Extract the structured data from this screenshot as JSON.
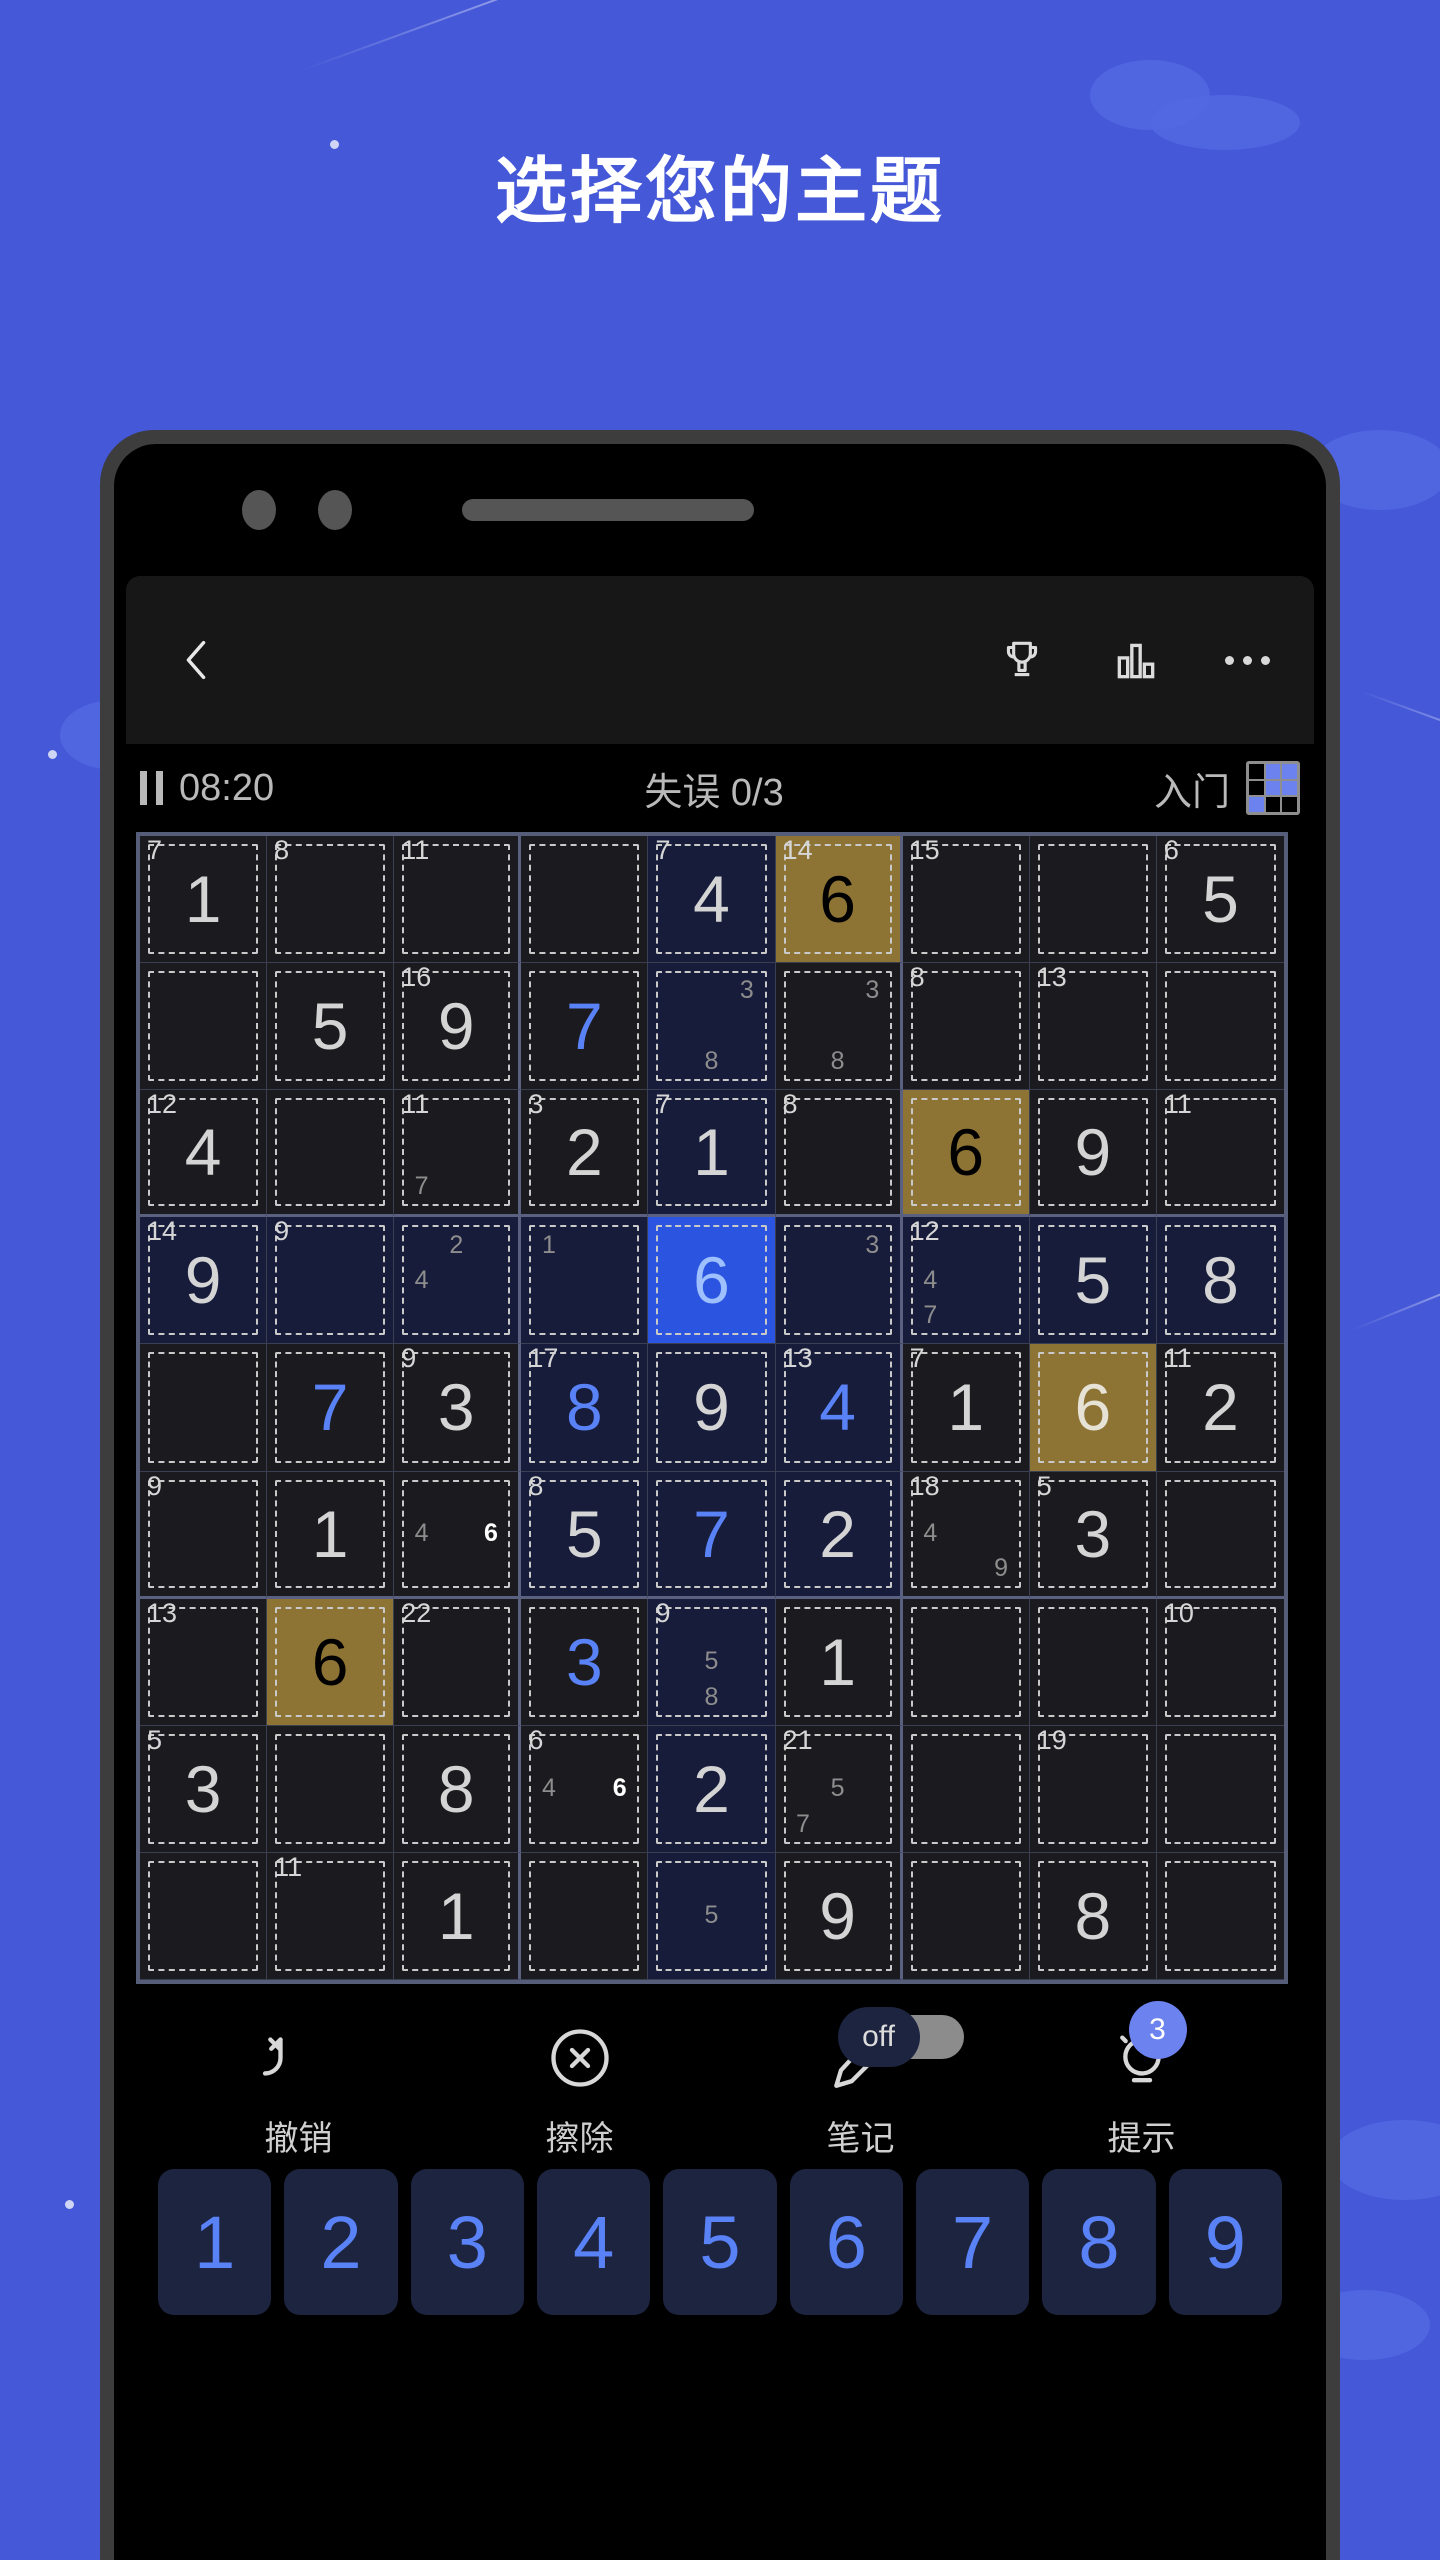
{
  "headline": "选择您的主题",
  "appbar": {
    "back_icon": "chevron-left-icon",
    "icons": [
      "trophy-icon",
      "stats-bar-icon",
      "more-dots-icon"
    ]
  },
  "status": {
    "pause_icon": "pause-icon",
    "timer": "08:20",
    "mistakes": "失误 0/3",
    "difficulty": "入门",
    "difficulty_grid": [
      0,
      1,
      1,
      0,
      1,
      1,
      1,
      0,
      0
    ]
  },
  "actions": [
    {
      "label": "撤销",
      "icon": "undo-arrow-icon"
    },
    {
      "label": "擦除",
      "icon": "erase-circle-x-icon"
    },
    {
      "label": "笔记",
      "icon": "pencil-note-icon",
      "toggle": "off"
    },
    {
      "label": "提示",
      "icon": "lightbulb-icon",
      "badge": "3"
    }
  ],
  "numpad": [
    "1",
    "2",
    "3",
    "4",
    "5",
    "6",
    "7",
    "8",
    "9"
  ],
  "colors": {
    "background": "#4458d8",
    "accent": "#5a82f7",
    "selected": "#2b55e0",
    "gold": "#8d7434",
    "board_bg": "#1b1b1f"
  },
  "board": {
    "selected": [
      3,
      4
    ],
    "rows": [
      [
        {
          "sum": "7",
          "v": "1",
          "t": "given",
          "cage": "tl"
        },
        {
          "sum": "8",
          "v": "",
          "cage": "tl"
        },
        {
          "sum": "11",
          "v": "",
          "cage": "tl"
        },
        {
          "v": "",
          "cage": "tr"
        },
        {
          "sum": "7",
          "v": "4",
          "t": "given",
          "hl": "col"
        },
        {
          "sum": "14",
          "v": "6",
          "t": "gold",
          "gold": true
        },
        {
          "sum": "15",
          "v": "",
          "cage": "tl"
        },
        {
          "v": "",
          "cage": "tr"
        },
        {
          "sum": "6",
          "v": "5",
          "t": "given",
          "cage": "tl"
        }
      ],
      [
        {
          "v": ""
        },
        {
          "v": "5",
          "t": "given"
        },
        {
          "sum": "16",
          "v": "9",
          "t": "given",
          "cage": "tl"
        },
        {
          "v": "7",
          "t": "user",
          "cage": "tr"
        },
        {
          "v": "",
          "notes": {
            "3": "3",
            "8": "8"
          },
          "hl": "col"
        },
        {
          "v": "",
          "notes": {
            "3": "3",
            "8": "8"
          }
        },
        {
          "sum": "8",
          "v": "",
          "cage": "tl"
        },
        {
          "sum": "13",
          "v": "",
          "cage": "tl"
        },
        {
          "v": ""
        }
      ],
      [
        {
          "sum": "12",
          "v": "4",
          "t": "given",
          "cage": "tl"
        },
        {
          "v": "",
          "cage": "tr"
        },
        {
          "sum": "11",
          "v": "",
          "notes": {
            "7": "7"
          }
        },
        {
          "sum": "3",
          "v": "2",
          "t": "given"
        },
        {
          "sum": "7",
          "v": "1",
          "t": "given",
          "hl": "col"
        },
        {
          "sum": "8",
          "v": ""
        },
        {
          "v": "6",
          "t": "gold",
          "gold": true
        },
        {
          "v": "9",
          "t": "given"
        },
        {
          "sum": "11",
          "v": ""
        }
      ],
      [
        {
          "sum": "14",
          "v": "9",
          "t": "given",
          "hl": "row"
        },
        {
          "sum": "9",
          "v": "",
          "hl": "row"
        },
        {
          "v": "",
          "notes": {
            "2": "2",
            "4": "4"
          },
          "hl": "row"
        },
        {
          "v": "",
          "notes": {
            "1": "1"
          },
          "hl": "row"
        },
        {
          "v": "6",
          "t": "onsel",
          "sel": true
        },
        {
          "v": "",
          "notes": {
            "3": "3"
          },
          "hl": "row"
        },
        {
          "sum": "12",
          "v": "",
          "notes": {
            "4": "4",
            "7": "7"
          },
          "hl": "row"
        },
        {
          "v": "5",
          "t": "given",
          "hl": "row"
        },
        {
          "v": "8",
          "t": "given",
          "hl": "row"
        }
      ],
      [
        {
          "v": ""
        },
        {
          "v": "7",
          "t": "user"
        },
        {
          "sum": "9",
          "v": "3",
          "t": "given"
        },
        {
          "sum": "17",
          "v": "8",
          "t": "user",
          "hl": "col"
        },
        {
          "v": "9",
          "t": "given",
          "hl": "col"
        },
        {
          "sum": "13",
          "v": "4",
          "t": "user",
          "hl": "col"
        },
        {
          "sum": "7",
          "v": "1",
          "t": "given"
        },
        {
          "v": "6",
          "t": "ongold",
          "gold": true
        },
        {
          "sum": "11",
          "v": "2",
          "t": "given"
        }
      ],
      [
        {
          "sum": "9",
          "v": ""
        },
        {
          "v": "1",
          "t": "given"
        },
        {
          "v": "",
          "notes": {
            "4": "4",
            "6": "6"
          },
          "bold": "6"
        },
        {
          "sum": "8",
          "v": "5",
          "t": "given",
          "hl": "col"
        },
        {
          "v": "7",
          "t": "user",
          "hl": "col"
        },
        {
          "v": "2",
          "t": "given",
          "hl": "col"
        },
        {
          "sum": "18",
          "v": "",
          "notes": {
            "4": "4",
            "9": "9"
          }
        },
        {
          "sum": "5",
          "v": "3",
          "t": "given"
        },
        {
          "v": ""
        }
      ],
      [
        {
          "sum": "13",
          "v": ""
        },
        {
          "v": "6",
          "t": "gold",
          "gold": true
        },
        {
          "sum": "22",
          "v": ""
        },
        {
          "v": "3",
          "t": "user"
        },
        {
          "sum": "9",
          "v": "",
          "notes": {
            "5": "5",
            "8": "8"
          },
          "hl": "col"
        },
        {
          "v": "1",
          "t": "given"
        },
        {
          "v": ""
        },
        {
          "v": ""
        },
        {
          "sum": "10",
          "v": ""
        }
      ],
      [
        {
          "sum": "5",
          "v": "3",
          "t": "given"
        },
        {
          "v": ""
        },
        {
          "v": "8",
          "t": "given"
        },
        {
          "sum": "6",
          "v": "",
          "notes": {
            "4": "4",
            "6": "6"
          },
          "bold": "6"
        },
        {
          "v": "2",
          "t": "given",
          "hl": "col"
        },
        {
          "sum": "21",
          "v": "",
          "notes": {
            "5": "5",
            "7": "7"
          }
        },
        {
          "v": ""
        },
        {
          "sum": "19",
          "v": ""
        },
        {
          "v": ""
        }
      ],
      [
        {
          "v": ""
        },
        {
          "sum": "11",
          "v": ""
        },
        {
          "v": "1",
          "t": "given"
        },
        {
          "v": ""
        },
        {
          "v": "",
          "notes": {
            "5": "5"
          },
          "hl": "col"
        },
        {
          "v": "9",
          "t": "given"
        },
        {
          "v": ""
        },
        {
          "v": "8",
          "t": "given"
        },
        {
          "v": ""
        }
      ]
    ]
  }
}
